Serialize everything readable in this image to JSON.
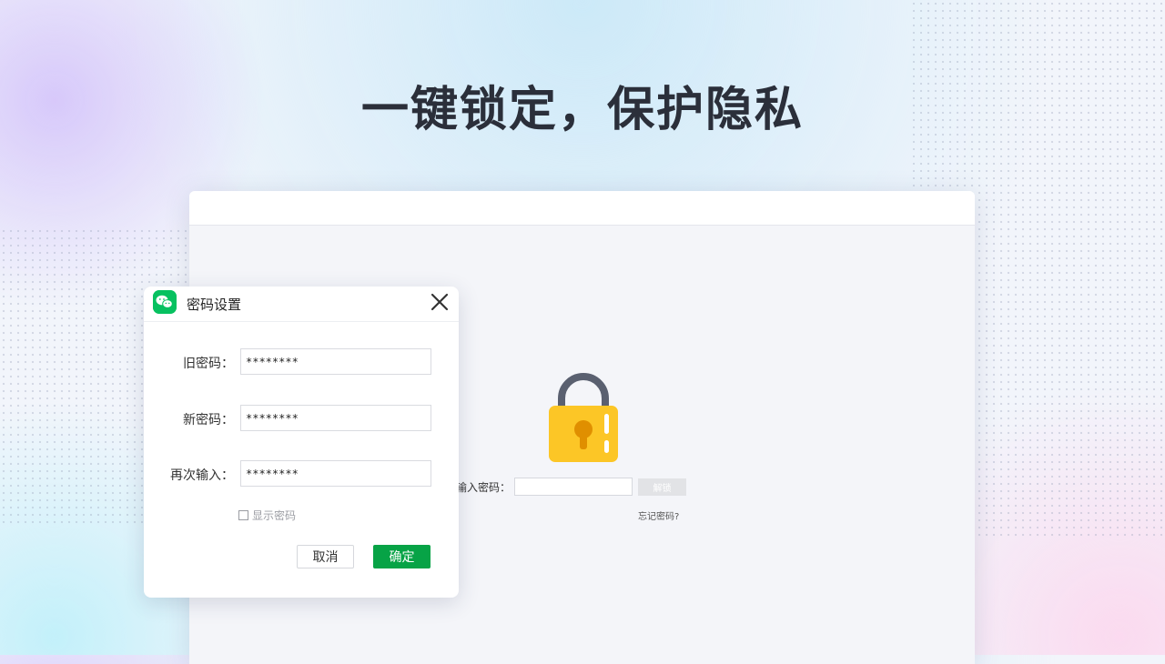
{
  "headline": "一键锁定，保护隐私",
  "lock_screen": {
    "password_label": "输入密码：",
    "password_value": "",
    "unlock_button": "解锁",
    "forgot_link": "忘记密码?"
  },
  "dialog": {
    "title": "密码设置",
    "fields": [
      {
        "label": "旧密码：",
        "value": "********"
      },
      {
        "label": "新密码：",
        "value": "********"
      },
      {
        "label": "再次输入：",
        "value": "********"
      }
    ],
    "show_password_label": "显示密码",
    "show_password_checked": false,
    "cancel_button": "取消",
    "confirm_button": "确定"
  },
  "colors": {
    "brand_green": "#07c160",
    "confirm_green": "#07a346",
    "lock_body": "#fcc626",
    "lock_shackle": "#5a6070",
    "keyhole": "#e08f00"
  },
  "icons": {
    "app_logo": "wechat-logo-icon",
    "close": "close-icon",
    "lock": "padlock-icon"
  }
}
